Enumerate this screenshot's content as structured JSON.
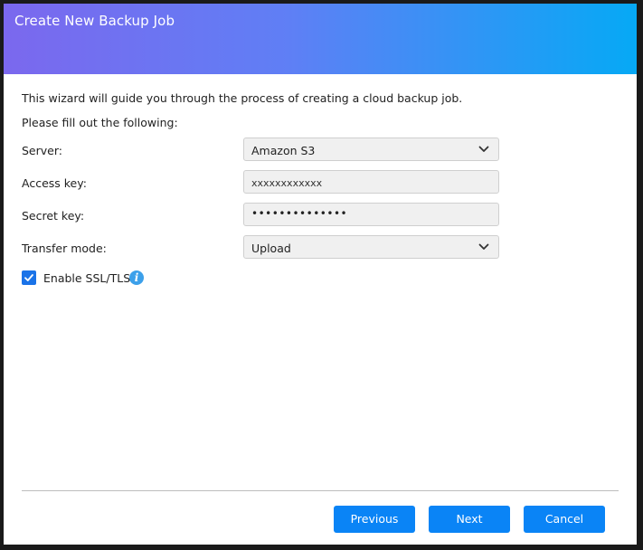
{
  "dialog": {
    "title": "Create New Backup Job",
    "intro": "This wizard will guide you through the process of creating a cloud backup job.",
    "subintro": "Please fill out the following:"
  },
  "form": {
    "server": {
      "label": "Server:",
      "value": "Amazon S3"
    },
    "access_key": {
      "label": "Access key:",
      "value": "xxxxxxxxxxxx"
    },
    "secret_key": {
      "label": "Secret key:",
      "value": "••••••••••••••"
    },
    "transfer_mode": {
      "label": "Transfer mode:",
      "value": "Upload"
    },
    "ssl": {
      "label": "Enable SSL/TLS",
      "checked": true
    }
  },
  "buttons": {
    "previous": "Previous",
    "next": "Next",
    "cancel": "Cancel"
  },
  "colors": {
    "accent": "#0a84f6",
    "header_start": "#7b68ee",
    "header_end": "#06a9f5",
    "info": "#3ca0ea"
  },
  "icons": {
    "dropdown": "chevron-down-icon",
    "info": "info-icon",
    "check": "checkmark-icon"
  }
}
